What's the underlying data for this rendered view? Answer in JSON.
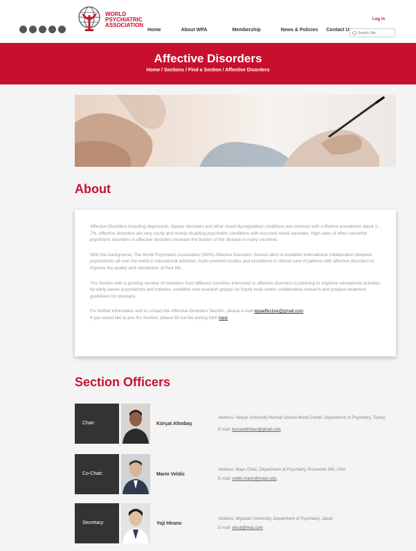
{
  "header": {
    "logo_lines": [
      "WORLD",
      "PSYCHIATRIC",
      "ASSOCIATION"
    ],
    "nav": [
      "Home",
      "About WPA",
      "Membership",
      "News & Policies",
      "Contact Us"
    ],
    "login": "Log in",
    "search_placeholder": "Search Site",
    "colors": {
      "brand": "#c8102e"
    }
  },
  "banner": {
    "title": "Affective Disorders",
    "breadcrumb": "Home / Sections / Find a Section / Affective Disorders"
  },
  "about": {
    "title": "About",
    "p1": "Affective Disorders including depression, bipolar disorders and other mood dysregulation conditions are common with a lifetime prevalence about 1–7%. Affective disorders are very costly and mostly disabling psychiatric conditions with recurrent mood episodes. High rates of other comorbid psychiatric disorders in affective disorders increase the burden of the disease in many countries.",
    "p2": "With this background, The World Psychiatric Association (WPA) Affective Disorders Section aims to establish international collaboration between psychiatrists all over the world in educational activities, multi-centered studies and excellence in clinical care of patients with affective disorders to improve the quality and satisfaction of their life.",
    "p3": "The Section with a growing number of members from different countries interested in affective disorders is planning to organize educational activities for early career psychiatrists and trainees, establish new research groups for future multi-center collaborative research and prepare treatment guidelines for clinicians.",
    "p4_a": "For further information and to contact the Affective Disorders Section, please e-mail",
    "p4_email": "wpaaffective@gmail.com",
    "p4_b": "If you would like to join the Section, please fill out the joining form",
    "p4_link": "here"
  },
  "officers": {
    "title": "Section Officers",
    "email_label": "E-mail:",
    "list": [
      {
        "role": "Chair:",
        "name": "Kürşat Altınbaş",
        "address": "Address: Selçuk University Mazhar Osman Mood Center, Department of Psychiatry, Turkey",
        "email": "kursataltinbas@gmail.com"
      },
      {
        "role": "Co-Chair:",
        "name": "Marin Veldic",
        "address": "Address: Mayo Clinic, Department of Psychiatry, Rochester MN, USA",
        "email": "veldic.marin@mayo.edu"
      },
      {
        "role": "Secretary:",
        "name": "Yoji Hirano",
        "address": "Address: Miyazaki University, Department of Psychiatry, Japan",
        "email": "yhcuj@mac.com"
      }
    ]
  }
}
